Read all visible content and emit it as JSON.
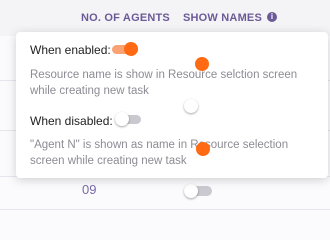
{
  "table": {
    "headers": {
      "agents": "NO. OF AGENTS",
      "show_names": "SHOW NAMES"
    },
    "visible_row_value": "09",
    "visible_row_toggle_state": "off"
  },
  "tooltip": {
    "enabled": {
      "label": "When enabled:",
      "description": "Resource name is show in Resource selction screen while creating new task",
      "toggle_state": "on"
    },
    "disabled": {
      "label": "When disabled:",
      "description": "\"Agent N\" is shown as name in Resource selection screen while creating new task",
      "toggle_state": "off"
    }
  },
  "icons": {
    "info": "info-icon"
  },
  "colors": {
    "accent": "#ff6a13",
    "header_text": "#6c5a98",
    "toggle_off": "#c9c9cf"
  }
}
